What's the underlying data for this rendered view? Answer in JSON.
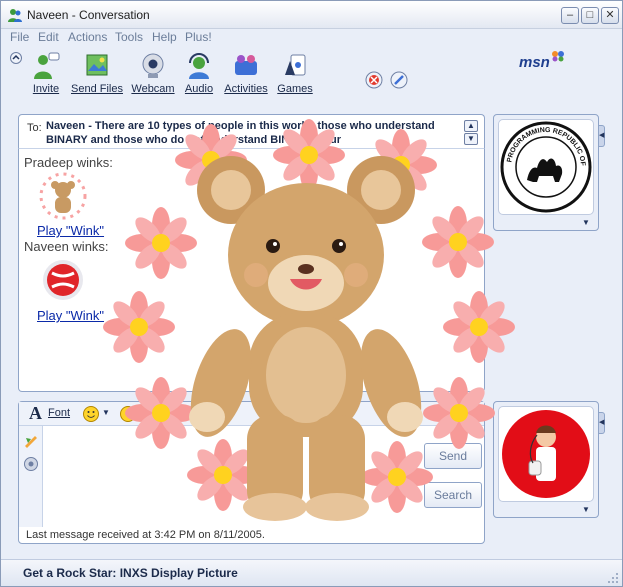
{
  "window": {
    "title": "Naveen - Conversation",
    "controls": [
      "minimize",
      "maximize",
      "close"
    ]
  },
  "menu": {
    "items": [
      "File",
      "Edit",
      "Actions",
      "Tools",
      "Help",
      "Plus!"
    ]
  },
  "toolbar": {
    "buttons": [
      {
        "label": "Invite",
        "icon": "invite-icon"
      },
      {
        "label": "Send Files",
        "icon": "send-files-icon"
      },
      {
        "label": "Webcam",
        "icon": "webcam-icon"
      },
      {
        "label": "Audio",
        "icon": "audio-icon"
      },
      {
        "label": "Activities",
        "icon": "activities-icon"
      },
      {
        "label": "Games",
        "icon": "games-icon"
      }
    ],
    "logo": "msn",
    "block_icon": "block-icon",
    "background_icon": "background-icon"
  },
  "to": {
    "label": "To:",
    "text": "Naveen - There are 10 types of people in this world, those who understand BINARY and those who do not understand BINARY. Your"
  },
  "history": {
    "lines": [
      {
        "text": "Pradeep winks:"
      },
      {
        "link": "Play \"Wink\""
      },
      {
        "text": "Naveen winks:"
      },
      {
        "link": "Play \"Wink\""
      }
    ]
  },
  "input": {
    "font_label": "Font",
    "send_label": "Send",
    "search_label": "Search"
  },
  "status": {
    "text": "Last message received at 3:42 PM on 8/11/2005."
  },
  "contact_picture": {
    "caption": "PROGRAMMING REPUBLIC OF PERL"
  },
  "ad": {
    "text": "Get a Rock Star: INXS Display Picture"
  },
  "colors": {
    "accent": "#1f3f8f",
    "link": "#0b2aa8",
    "disabled_text": "#6a7c9c",
    "bear": "#c89a63",
    "flower": "#f58d8d"
  }
}
